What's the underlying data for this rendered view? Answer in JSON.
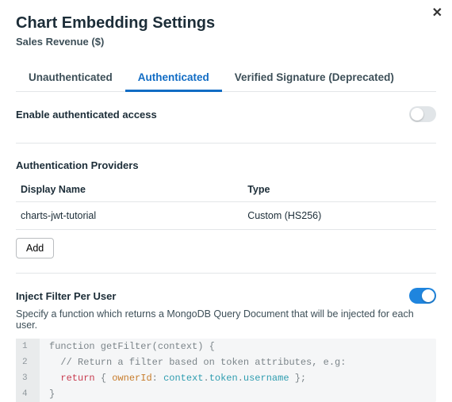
{
  "modal": {
    "title": "Chart Embedding Settings",
    "subtitle": "Sales Revenue ($)"
  },
  "tabs": {
    "unauth": "Unauthenticated",
    "auth": "Authenticated",
    "verified": "Verified Signature (Deprecated)"
  },
  "enable": {
    "label": "Enable authenticated access"
  },
  "providers": {
    "heading": "Authentication Providers",
    "col_name": "Display Name",
    "col_type": "Type",
    "row0_name": "charts-jwt-tutorial",
    "row0_type": "Custom (HS256)",
    "add_label": "Add"
  },
  "filter": {
    "heading": "Inject Filter Per User",
    "desc": "Specify a function which returns a MongoDB Query Document that will be injected for each user."
  },
  "code": {
    "ln1": "1",
    "ln2": "2",
    "ln3": "3",
    "ln4": "4",
    "l1a": "function",
    "l1b": " getFilter(",
    "l1c": "context",
    "l1d": ") {",
    "l2": "  // Return a filter based on token attributes, e.g:",
    "l3a": "  ",
    "l3b": "return",
    "l3c": " { ",
    "l3d": "ownerId",
    "l3e": ": ",
    "l3f": "context",
    "l3g": ".",
    "l3h": "token",
    "l3i": ".",
    "l3j": "username",
    "l3k": " };",
    "l4": "}"
  }
}
